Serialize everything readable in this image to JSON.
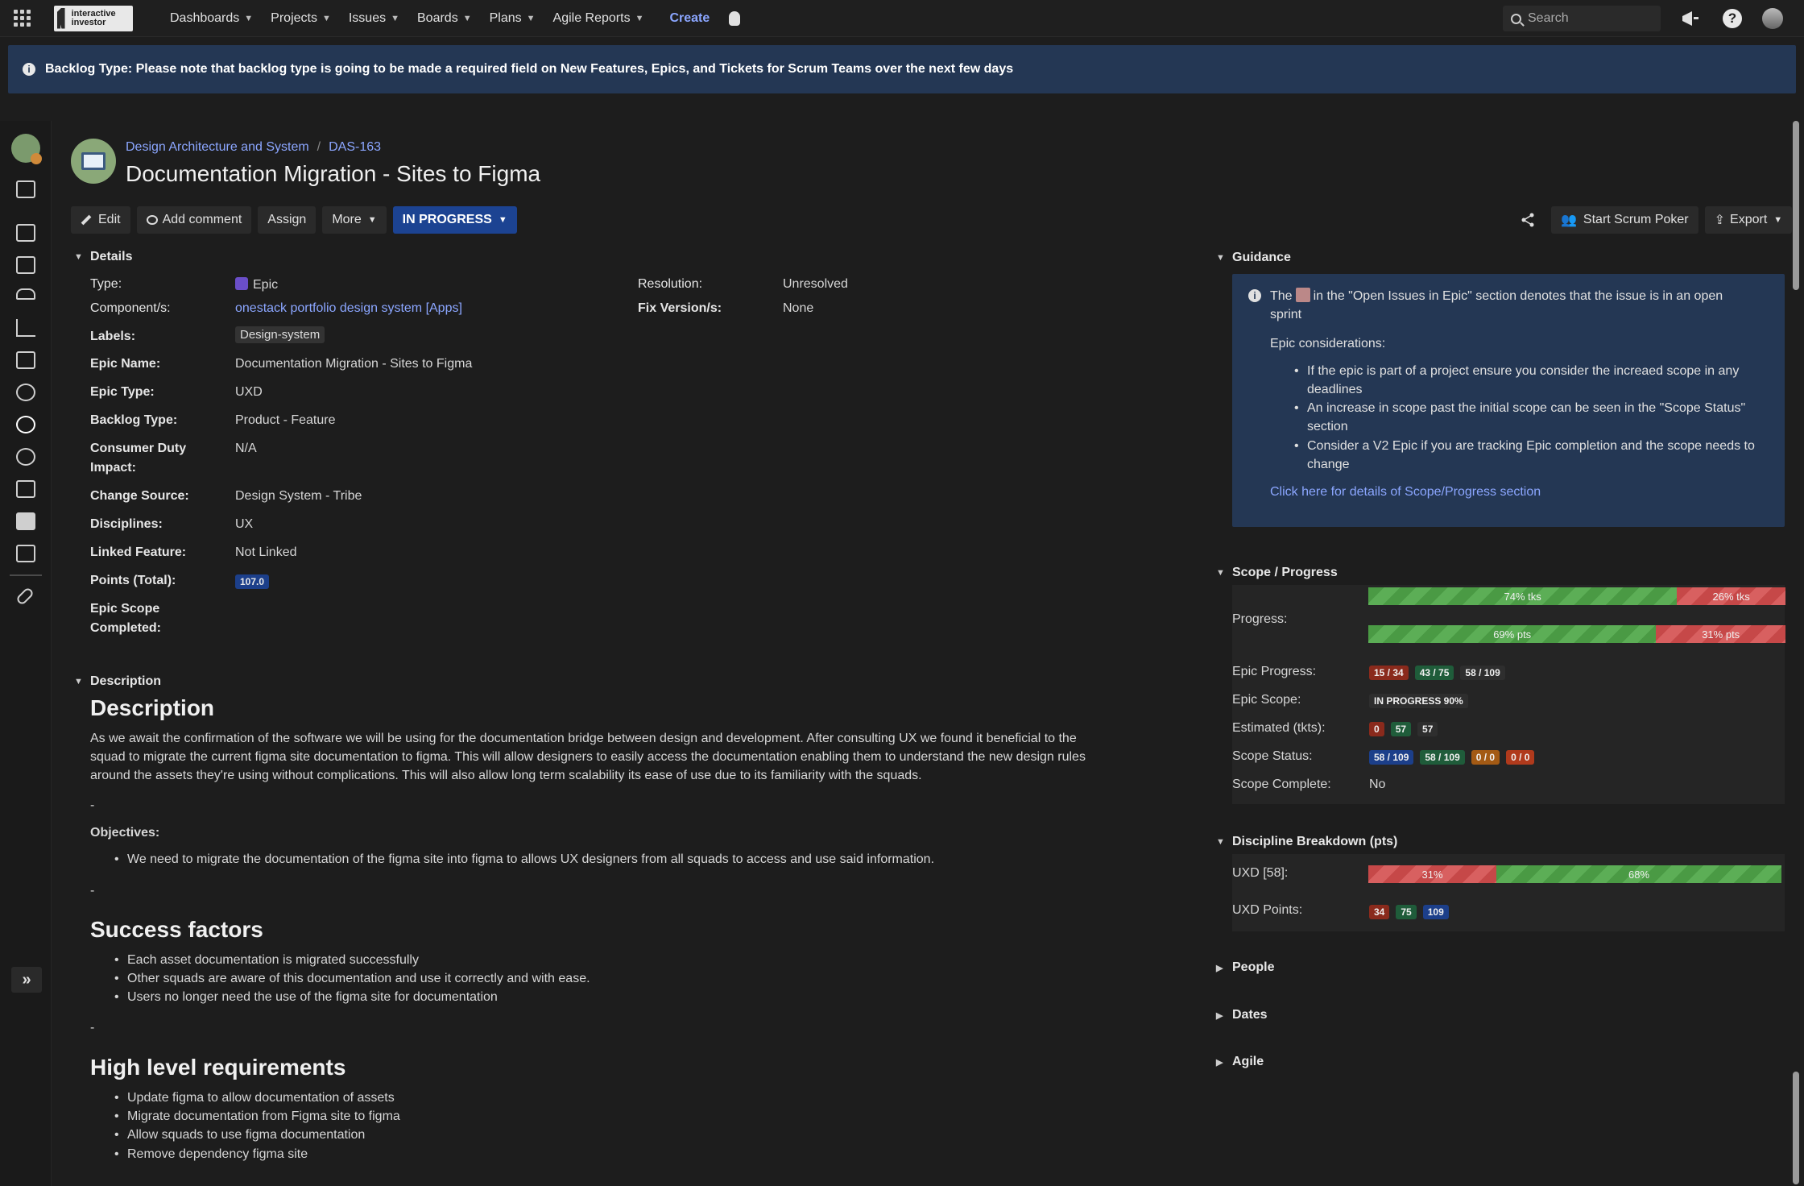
{
  "nav": {
    "logo_text": "interactive investor",
    "menu": [
      "Dashboards",
      "Projects",
      "Issues",
      "Boards",
      "Plans",
      "Agile Reports"
    ],
    "create": "Create",
    "search_placeholder": "Search"
  },
  "banner": {
    "text": "Backlog Type: Please note that backlog type is going to be made a required field on New Features, Epics, and Tickets for Scrum Teams over the next few days"
  },
  "breadcrumb": {
    "project": "Design Architecture and System",
    "issue_key": "DAS-163"
  },
  "issue": {
    "title": "Documentation Migration - Sites to Figma"
  },
  "toolbar": {
    "edit": "Edit",
    "add_comment": "Add comment",
    "assign": "Assign",
    "more": "More",
    "status": "IN PROGRESS",
    "start_scrum_poker": "Start Scrum Poker",
    "export": "Export"
  },
  "details": {
    "heading": "Details",
    "type_label": "Type:",
    "type_value": "Epic",
    "component_label": "Component/s:",
    "component_value": "onestack portfolio design system [Apps]",
    "labels_label": "Labels:",
    "labels_value": "Design-system",
    "epic_name_label": "Epic Name:",
    "epic_name_value": "Documentation Migration - Sites to Figma",
    "epic_type_label": "Epic Type:",
    "epic_type_value": "UXD",
    "backlog_type_label": "Backlog Type:",
    "backlog_type_value": "Product - Feature",
    "consumer_duty_label_1": "Consumer Duty",
    "consumer_duty_label_2": "Impact:",
    "consumer_duty_value": "N/A",
    "change_source_label": "Change Source:",
    "change_source_value": "Design System - Tribe",
    "disciplines_label": "Disciplines:",
    "disciplines_value": "UX",
    "linked_feature_label": "Linked Feature:",
    "linked_feature_value": "Not Linked",
    "points_label": "Points (Total):",
    "points_value": "107.0",
    "epic_scope_label_1": "Epic Scope",
    "epic_scope_label_2": "Completed:",
    "resolution_label": "Resolution:",
    "resolution_value": "Unresolved",
    "fix_version_label": "Fix Version/s:",
    "fix_version_value": "None"
  },
  "description": {
    "heading": "Description",
    "title": "Description",
    "para_1": "As we await the confirmation of the software we will be using for the documentation bridge between design and development. After consulting UX we found it beneficial to the",
    "para_2": "squad to migrate the current figma site documentation to figma. This will allow designers to easily access the documentation enabling them to understand the new design rules",
    "para_3": "around the assets they're using without complications. This will also allow long term scalability its ease of use due to its familiarity with the squads.",
    "dash": "-",
    "objectives_label": "Objectives:",
    "objectives": [
      "We need to migrate the documentation of the figma site into figma to allows UX designers from all squads to access and use said information."
    ],
    "success_title": "Success factors",
    "success": [
      "Each asset documentation is migrated successfully",
      "Other squads are aware of this documentation and use it correctly and with ease.",
      "Users no longer need the use of the figma site for documentation"
    ],
    "requirements_title": "High level requirements",
    "requirements": [
      "Update figma to allow documentation of assets",
      "Migrate documentation from Figma site to figma",
      "Allow squads to use figma documentation",
      "Remove dependency figma site"
    ]
  },
  "guidance": {
    "heading": "Guidance",
    "line_1a": "The",
    "line_1b": "in the \"Open Issues in Epic\" section denotes that the issue is in an open",
    "line_1c": "sprint",
    "considerations": "Epic considerations:",
    "bullets": [
      "If the epic is part of a project ensure you consider the increaed scope in any deadlines",
      "An increase in scope past the initial scope can be seen in the \"Scope Status\" section",
      "Consider a V2 Epic if you are tracking Epic completion and the scope needs to change"
    ],
    "link": "Click here for details of Scope/Progress section"
  },
  "scope": {
    "heading": "Scope / Progress",
    "progress_label": "Progress:",
    "tkts_done_pct": 74,
    "tkts_done_label": "74% tks",
    "tkts_left_label": "26% tks",
    "pts_done_pct": 69,
    "pts_done_label": "69% pts",
    "pts_left_label": "31% pts",
    "epic_progress_label": "Epic Progress:",
    "epic_progress": [
      "15 / 34",
      "43 / 75",
      "58 / 109"
    ],
    "epic_scope_label": "Epic Scope:",
    "epic_scope": "IN PROGRESS 90%",
    "estimated_label": "Estimated (tkts):",
    "estimated": [
      "0",
      "57",
      "57"
    ],
    "scope_status_label": "Scope Status:",
    "scope_status": [
      "58 / 109",
      "58 / 109",
      "0 / 0",
      "0 / 0"
    ],
    "scope_complete_label": "Scope Complete:",
    "scope_complete": "No"
  },
  "discipline": {
    "heading": "Discipline Breakdown (pts)",
    "uxd_label": "UXD [58]:",
    "uxd_left_pct": 31,
    "uxd_left_label": "31%",
    "uxd_done_label": "68%",
    "points_label": "UXD Points:",
    "points": [
      "34",
      "75",
      "109"
    ]
  },
  "collapsed": {
    "people": "People",
    "dates": "Dates",
    "agile": "Agile"
  },
  "colors": {
    "accent": "#8ba6ff",
    "status_blue": "#1c4392",
    "banner_bg": "#243754",
    "progress_green": "#4a9a44",
    "progress_red": "#c64848"
  }
}
